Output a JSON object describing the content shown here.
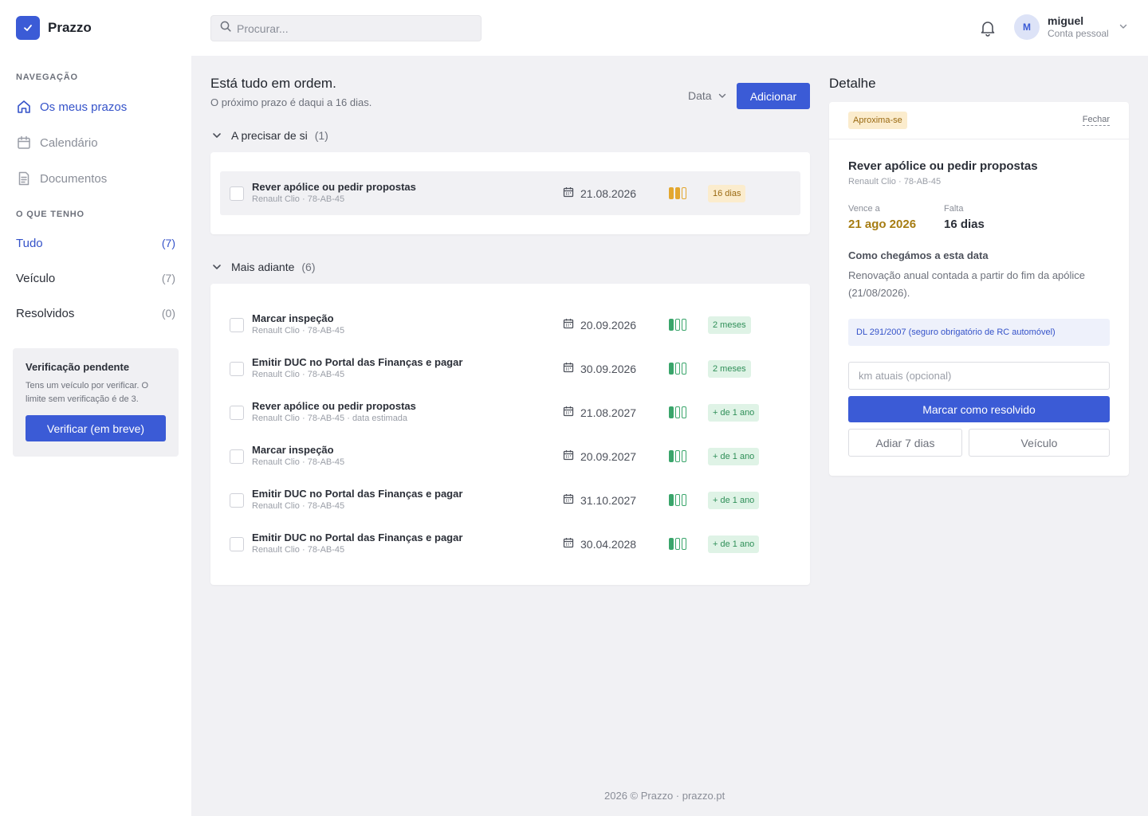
{
  "app": {
    "name": "Prazzo",
    "logo_icon": "check-icon",
    "accent": "#3b5bd6"
  },
  "header": {
    "search_placeholder": "Procurar...",
    "user_initial": "M",
    "user_name": "miguel",
    "user_account": "Conta pessoal"
  },
  "sidebar": {
    "nav_heading": "NAVEGAÇÃO",
    "nav": [
      {
        "label": "Os meus prazos",
        "icon": "home-icon",
        "active": true
      },
      {
        "label": "Calendário",
        "icon": "calendar-icon",
        "active": false
      },
      {
        "label": "Documentos",
        "icon": "document-icon",
        "active": false
      }
    ],
    "filters_heading": "O QUE TENHO",
    "filters": [
      {
        "label": "Tudo",
        "count": "(7)",
        "active": true
      },
      {
        "label": "Veículo",
        "count": "(7)",
        "active": false
      },
      {
        "label": "Resolvidos",
        "count": "(0)",
        "active": false
      }
    ],
    "verify": {
      "title": "Verificação pendente",
      "text": "Tens um veículo por verificar. O limite sem verificação é de 3.",
      "button": "Verificar (em breve)"
    }
  },
  "main": {
    "title": "Está tudo em ordem.",
    "subtitle": "O próximo prazo é daqui a 16 dias.",
    "sort_label": "Data",
    "add_label": "Adicionar",
    "groups": [
      {
        "label": "A precisar de si",
        "count": "(1)",
        "items": [
          {
            "title": "Rever apólice ou pedir propostas",
            "sub": "Renault Clio · 78-AB-45",
            "date": "21.08.2026",
            "level": 2,
            "status": "warn",
            "badge": "16 dias"
          }
        ]
      },
      {
        "label": "Mais adiante",
        "count": "(6)",
        "items": [
          {
            "title": "Marcar inspeção",
            "sub": "Renault Clio · 78-AB-45",
            "date": "20.09.2026",
            "level": 1,
            "status": "ok",
            "badge": "2 meses"
          },
          {
            "title": "Emitir DUC no Portal das Finanças e pagar",
            "sub": "Renault Clio · 78-AB-45",
            "date": "30.09.2026",
            "level": 1,
            "status": "ok",
            "badge": "2 meses"
          },
          {
            "title": "Rever apólice ou pedir propostas",
            "sub": "Renault Clio · 78-AB-45 · data estimada",
            "date": "21.08.2027",
            "level": 1,
            "status": "ok",
            "badge": "+ de 1 ano"
          },
          {
            "title": "Marcar inspeção",
            "sub": "Renault Clio · 78-AB-45",
            "date": "20.09.2027",
            "level": 1,
            "status": "ok",
            "badge": "+ de 1 ano"
          },
          {
            "title": "Emitir DUC no Portal das Finanças e pagar",
            "sub": "Renault Clio · 78-AB-45",
            "date": "31.10.2027",
            "level": 1,
            "status": "ok",
            "badge": "+ de 1 ano"
          },
          {
            "title": "Emitir DUC no Portal das Finanças e pagar",
            "sub": "Renault Clio · 78-AB-45",
            "date": "30.04.2028",
            "level": 1,
            "status": "ok",
            "badge": "+ de 1 ano"
          }
        ]
      }
    ]
  },
  "detail": {
    "heading": "Detalhe",
    "status": "Aproxima-se",
    "close": "Fechar",
    "title": "Rever apólice ou pedir propostas",
    "sub": "Renault Clio · 78-AB-45",
    "due_label": "Vence a",
    "due_value": "21 ago 2026",
    "left_label": "Falta",
    "left_value": "16 dias",
    "section": "Como chegámos a esta data",
    "explanation": "Renovação anual contada a partir do fim da apólice (21/08/2026).",
    "law_link": "DL 291/2007 (seguro obrigatório de RC automóvel)",
    "km_placeholder": "km atuais (opcional)",
    "resolve": "Marcar como resolvido",
    "postpone": "Adiar 7 dias",
    "vehicle": "Veículo"
  },
  "footer": "2026 © Prazzo · prazzo.pt",
  "colors": {
    "ok": "#3aa56b",
    "ok_badge_bg": "#dff3e6",
    "ok_badge_text": "#2f8f58",
    "warn": "#e3a72f",
    "warn_badge_bg": "#fbeccd",
    "warn_badge_text": "#9a6a12",
    "due_text": "#a67c12"
  }
}
